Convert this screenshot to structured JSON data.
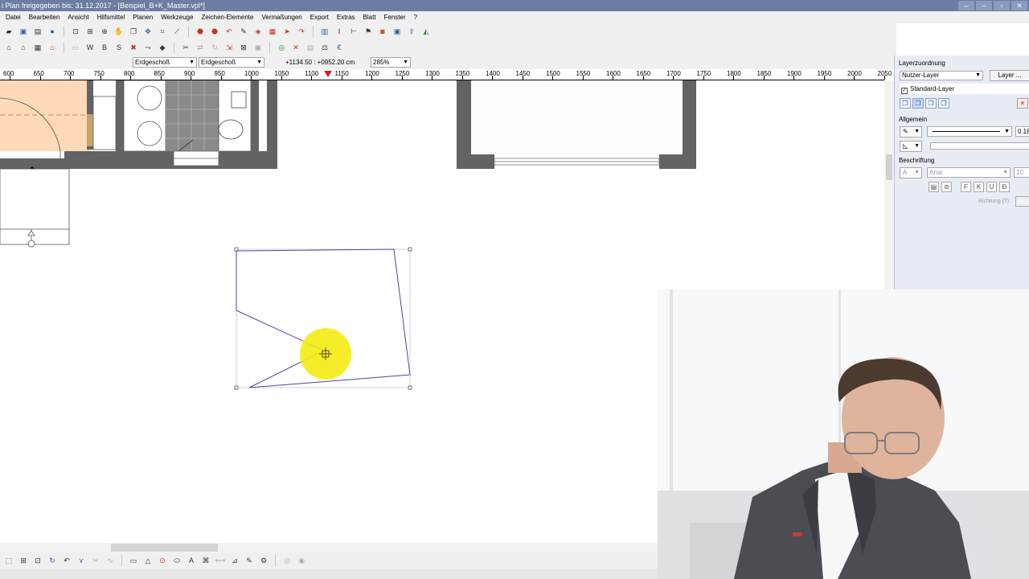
{
  "window": {
    "title": "i Plan freigegeben bis: 31.12.2017 - [Beispiel_B+K_Master.vpl*]",
    "controls": [
      "⇔",
      "–",
      "▫",
      "✕"
    ]
  },
  "menu": [
    "Datei",
    "Bearbeiten",
    "Ansicht",
    "Hilfsmittel",
    "Planen",
    "Werkzeuge",
    "Zeichen-Elemente",
    "Vermaßungen",
    "Export",
    "Extras",
    "Blatt",
    "Fenster",
    "?"
  ],
  "toolbar_row1": [
    "folder-open-icon",
    "save-icon",
    "print-icon",
    "info-icon",
    "zoom-window-icon",
    "zoom-all-icon",
    "zoom-in-icon",
    "pan-hand-icon",
    "copy-icon",
    "move-icon",
    "snap-icon",
    "measure-icon",
    "stop-icon",
    "stop2-icon",
    "undo-icon",
    "pencil-icon",
    "brush-icon",
    "hatch-icon",
    "arrow-icon",
    "redo-icon",
    "grid-icon",
    "text-icon",
    "dimension-icon",
    "flag-icon",
    "camera-icon",
    "print3d-icon",
    "export-icon",
    "color-icon"
  ],
  "toolbar_row2": [
    "move-tool-icon",
    "house-icon",
    "layer-icon",
    "house-red-icon",
    "wall-icon",
    "walls-icon",
    "window-icon",
    "stairs-icon",
    "delete-red-icon",
    "paint-icon",
    "fill-icon",
    "compass-icon",
    "copy-icon",
    "mirror-icon",
    "rotate-icon",
    "stretch-icon",
    "curve-icon",
    "image-icon",
    "target-icon",
    "close-red-icon",
    "sheet-icon",
    "scale-icon",
    "euro-icon"
  ],
  "statusbar": {
    "floor1": "Erdgeschoß",
    "floor2": "Erdgeschoß",
    "coords": "+1134.50 : +0952.20 cm",
    "zoom": "285%"
  },
  "ruler": {
    "labels": [
      "600",
      "650",
      "700",
      "750",
      "800",
      "850",
      "900",
      "950",
      "1000",
      "1050",
      "1100",
      "1150",
      "1200",
      "1250",
      "1300",
      "1350",
      "1400",
      "1450",
      "1500",
      "1550",
      "1600",
      "1650",
      "1700",
      "1750",
      "1800",
      "1850",
      "1900",
      "1950",
      "2000",
      "2050"
    ],
    "cursor": 1130
  },
  "rpanel": {
    "title": "Layerzuordnung",
    "layer_combo": "Nutzer-Layer",
    "layer_button": "Layer ...",
    "standard_layer": "Standard-Layer",
    "icons": [
      "layer-copy-icon",
      "layer-active-icon",
      "layer-new-icon",
      "layer-merge-icon"
    ],
    "section_general": "Allgemein",
    "line_value": "0.18",
    "section_label": "Beschriftung",
    "font": "Arial",
    "font_size": "10",
    "text_format": [
      "F",
      "K",
      "U",
      "Ð"
    ],
    "direction_label": "Richtung (?)"
  },
  "bottom_tools": [
    "select-icon",
    "zoom-icon",
    "node-icon",
    "rotate-icon",
    "undo-icon",
    "polyline-icon",
    "trim-icon",
    "spline-icon",
    "arc-icon",
    "circle-icon",
    "ellipse-icon",
    "text-icon",
    "symbol-icon",
    "dimension-icon",
    "hatch-icon",
    "edit-icon",
    "special-icon"
  ],
  "colors": {
    "titlebar": "#6b7ea1",
    "room_fill": "#ffd9b8",
    "wall": "#636363",
    "polyline": "#4a4a9a",
    "cursor_highlight": "#f5eb12",
    "panel_bg": "#e8ecf4"
  }
}
